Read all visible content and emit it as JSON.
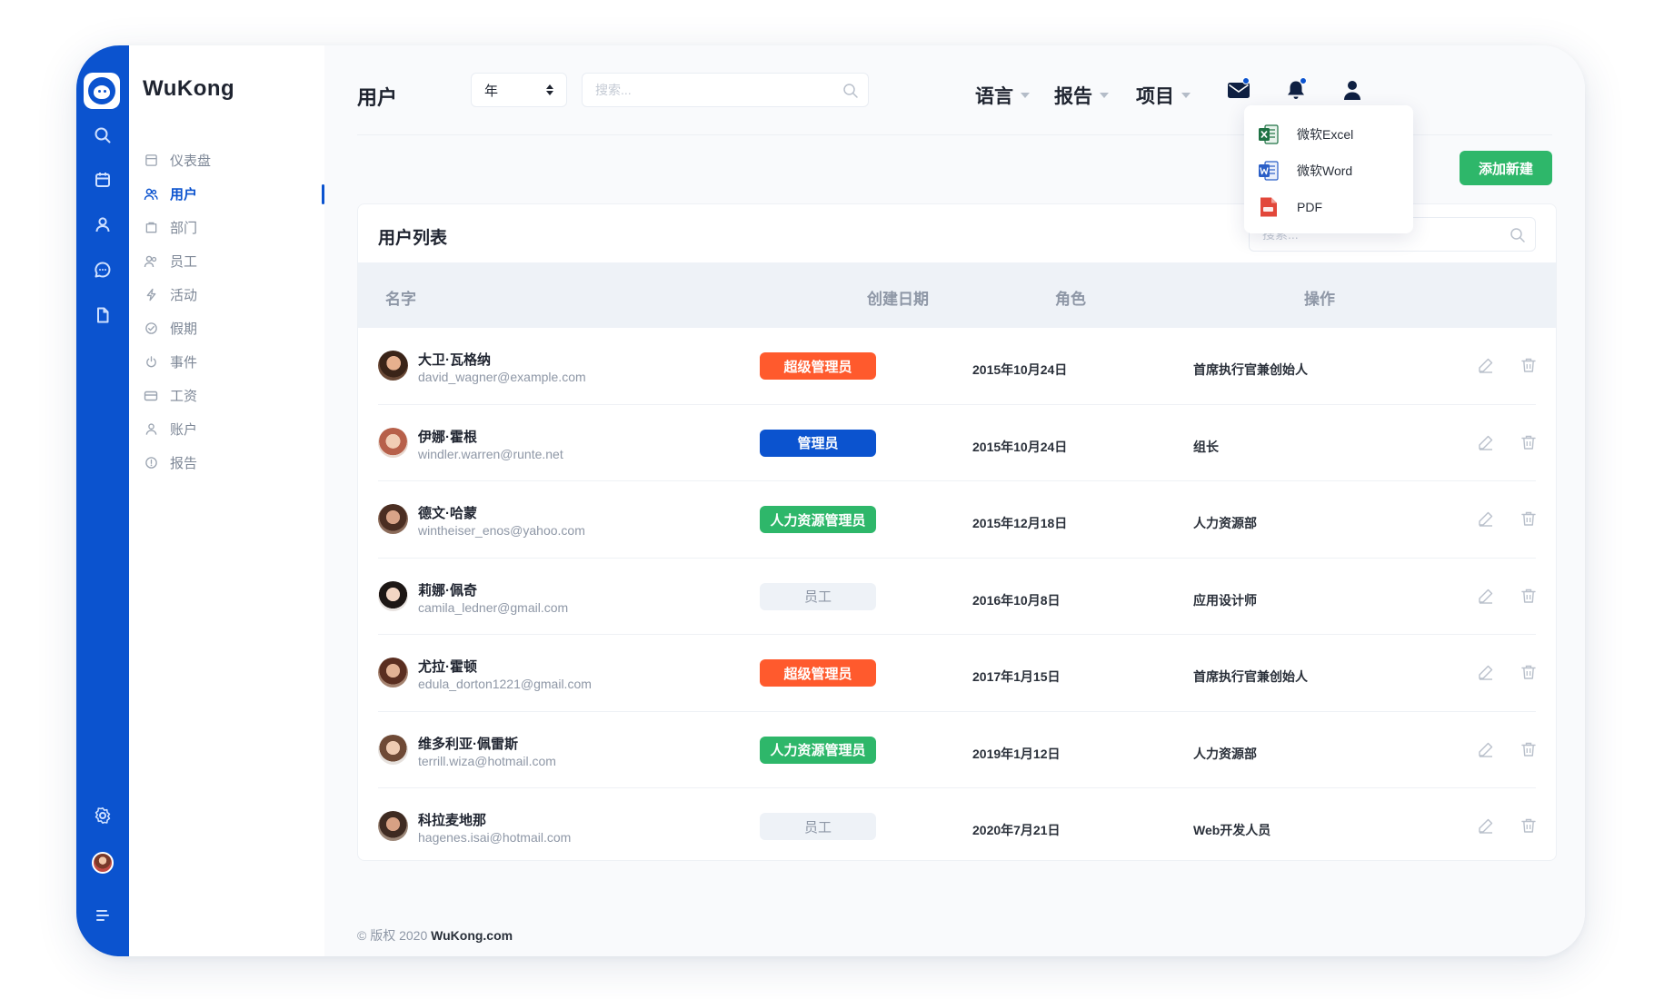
{
  "app": {
    "brand": "WuKong"
  },
  "header": {
    "page_title": "用户",
    "year_select": "年",
    "search_placeholder": "搜索...",
    "menus": [
      {
        "label": "语言"
      },
      {
        "label": "报告"
      },
      {
        "label": "项目"
      }
    ]
  },
  "report_dropdown": {
    "items": [
      {
        "label": "微软Excel",
        "icon": "excel-icon",
        "color": "#1f7244"
      },
      {
        "label": "微软Word",
        "icon": "word-icon",
        "color": "#2b5fc7"
      },
      {
        "label": "PDF",
        "icon": "pdf-icon",
        "color": "#e2473a"
      }
    ]
  },
  "sidebar": {
    "items": [
      {
        "label": "仪表盘",
        "icon": "dashboard-icon"
      },
      {
        "label": "用户",
        "icon": "users-icon",
        "active": true
      },
      {
        "label": "部门",
        "icon": "department-icon"
      },
      {
        "label": "员工",
        "icon": "employees-icon"
      },
      {
        "label": "活动",
        "icon": "activity-icon"
      },
      {
        "label": "假期",
        "icon": "holiday-icon"
      },
      {
        "label": "事件",
        "icon": "event-icon"
      },
      {
        "label": "工资",
        "icon": "salary-icon"
      },
      {
        "label": "账户",
        "icon": "account-icon"
      },
      {
        "label": "报告",
        "icon": "report-icon"
      }
    ]
  },
  "main": {
    "add_button": "添加新建",
    "list_title": "用户列表",
    "list_search_placeholder": "搜索...",
    "columns": [
      "名字",
      "创建日期",
      "角色",
      "操作"
    ],
    "users": [
      {
        "name": "大卫·瓦格纳",
        "email": "david_wagner@example.com",
        "badge": "超级管理员",
        "badge_type": "super",
        "date": "2015年10月24日",
        "role": "首席执行官兼创始人"
      },
      {
        "name": "伊娜·霍根",
        "email": "windler.warren@runte.net",
        "badge": "管理员",
        "badge_type": "admin",
        "date": "2015年10月24日",
        "role": "组长"
      },
      {
        "name": "德文·哈蒙",
        "email": "wintheiser_enos@yahoo.com",
        "badge": "人力资源管理员",
        "badge_type": "hr",
        "date": "2015年12月18日",
        "role": "人力资源部"
      },
      {
        "name": "莉娜·佩奇",
        "email": "camila_ledner@gmail.com",
        "badge": "员工",
        "badge_type": "staff",
        "date": "2016年10月8日",
        "role": "应用设计师"
      },
      {
        "name": "尤拉·霍顿",
        "email": "edula_dorton1221@gmail.com",
        "badge": "超级管理员",
        "badge_type": "super",
        "date": "2017年1月15日",
        "role": "首席执行官兼创始人"
      },
      {
        "name": "维多利亚·佩雷斯",
        "email": "terrill.wiza@hotmail.com",
        "badge": "人力资源管理员",
        "badge_type": "hr",
        "date": "2019年1月12日",
        "role": "人力资源部"
      },
      {
        "name": "科拉麦地那",
        "email": "hagenes.isai@hotmail.com",
        "badge": "员工",
        "badge_type": "staff",
        "date": "2020年7月21日",
        "role": "Web开发人员"
      }
    ]
  },
  "badge_colors": {
    "super": "#ff5a2d",
    "admin": "#0b53cf",
    "hr": "#2eb76a",
    "staff_bg": "#eef2f7",
    "staff_text": "#8e97a6"
  },
  "footer": {
    "prefix": "© 版权 2020",
    "site": "WuKong.com"
  },
  "colors": {
    "primary": "#0b53cf",
    "success": "#2eb76a"
  }
}
